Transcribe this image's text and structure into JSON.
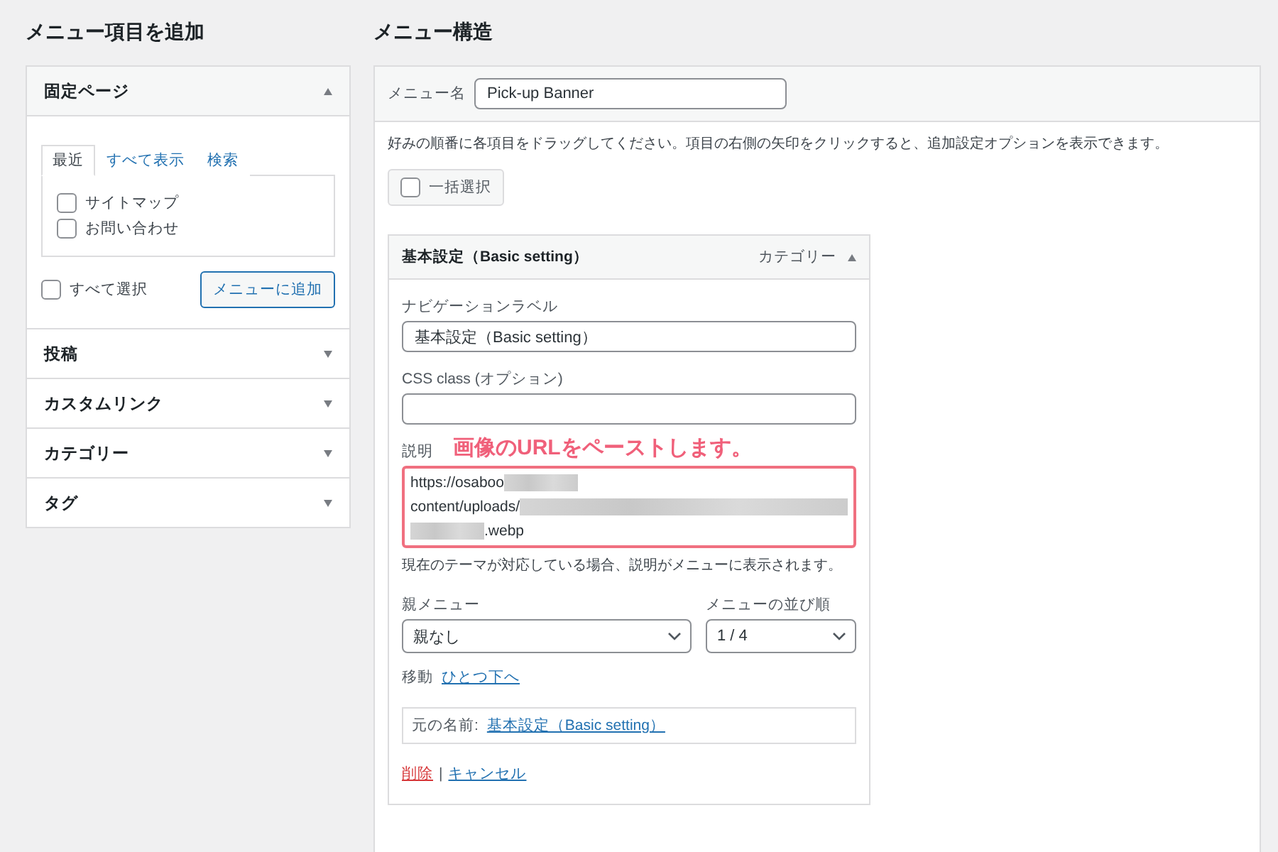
{
  "left": {
    "heading": "メニュー項目を追加",
    "sections": [
      {
        "title": "固定ページ",
        "expanded": true,
        "tabs": [
          {
            "label": "最近",
            "selected": true
          },
          {
            "label": "すべて表示",
            "selected": false
          },
          {
            "label": "検索",
            "selected": false
          }
        ],
        "items": [
          {
            "label": "サイトマップ",
            "checked": false
          },
          {
            "label": "お問い合わせ",
            "checked": false
          }
        ],
        "select_all": {
          "label": "すべて選択",
          "checked": false
        },
        "add_button": "メニューに追加"
      },
      {
        "title": "投稿",
        "expanded": false
      },
      {
        "title": "カスタムリンク",
        "expanded": false
      },
      {
        "title": "カテゴリー",
        "expanded": false
      },
      {
        "title": "タグ",
        "expanded": false
      }
    ]
  },
  "right": {
    "heading": "メニュー構造",
    "menu_name": {
      "label": "メニュー名",
      "value": "Pick-up Banner"
    },
    "instructions": "好みの順番に各項目をドラッグしてください。項目の右側の矢印をクリックすると、追加設定オプションを表示できます。",
    "bulk_select": {
      "label": "一括選択",
      "checked": false
    },
    "item": {
      "title": "基本設定（Basic setting）",
      "type": "カテゴリー",
      "expanded": true,
      "nav_label": {
        "label": "ナビゲーションラベル",
        "value": "基本設定（Basic setting）"
      },
      "css_class": {
        "label": "CSS class (オプション)"
      },
      "description": {
        "label": "説明",
        "annotation": "画像のURLをペーストします。",
        "lines": [
          [
            {
              "kind": "text",
              "text": "https://osaboo"
            },
            {
              "kind": "blur"
            }
          ],
          [
            {
              "kind": "text",
              "text": "content/uploads/"
            },
            {
              "kind": "blurfill"
            }
          ],
          [
            {
              "kind": "blur"
            },
            {
              "kind": "text",
              "text": ".webp"
            }
          ]
        ]
      },
      "help": "現在のテーマが対応している場合、説明がメニューに表示されます。",
      "parent": {
        "label": "親メニュー",
        "value": "親なし"
      },
      "order": {
        "label": "メニューの並び順",
        "value": "1 / 4"
      },
      "move": {
        "label": "移動",
        "link": "ひとつ下へ"
      },
      "original": {
        "label": "元の名前:",
        "link": "基本設定（Basic setting）"
      },
      "delete": "削除",
      "separator": "|",
      "cancel": "キャンセル"
    }
  }
}
